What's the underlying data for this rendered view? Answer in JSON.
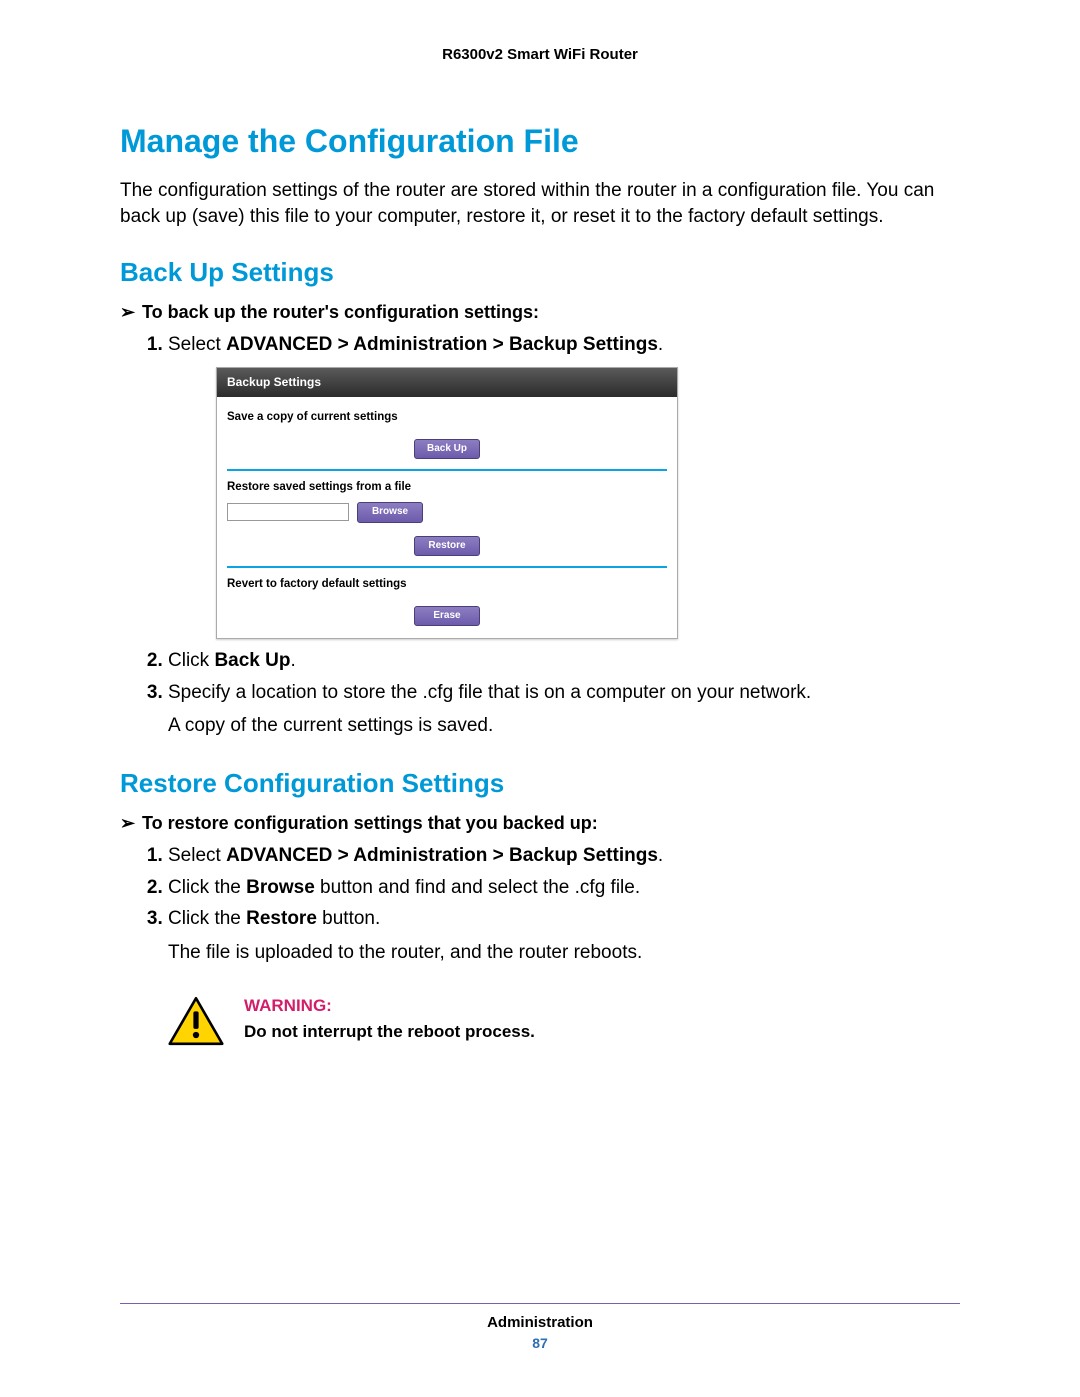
{
  "doc_header": "R6300v2 Smart WiFi Router",
  "h1": "Manage the Configuration File",
  "intro": "The configuration settings of the router are stored within the router in a configuration file. You can back up (save) this file to your computer, restore it, or reset it to the factory default settings.",
  "backup": {
    "heading": "Back Up Settings",
    "task_title": "To back up the router's configuration settings:",
    "steps": {
      "s1_pre": "Select ",
      "s1_bold": "ADVANCED > Administration > Backup Settings",
      "s1_post": ".",
      "s2_pre": "Click ",
      "s2_bold": "Back Up",
      "s2_post": ".",
      "s3": "Specify a location to store the .cfg file that is on a computer on your network.",
      "s3_note": "A copy of the current settings is saved."
    }
  },
  "panel": {
    "title": "Backup Settings",
    "save_label": "Save a copy of current settings",
    "backup_btn": "Back Up",
    "restore_label": "Restore saved settings from a file",
    "browse_btn": "Browse",
    "restore_btn": "Restore",
    "revert_label": "Revert to factory default settings",
    "erase_btn": "Erase"
  },
  "restore": {
    "heading": "Restore Configuration Settings",
    "task_title": "To restore configuration settings that you backed up:",
    "steps": {
      "s1_pre": "Select ",
      "s1_bold": "ADVANCED > Administration > Backup Settings",
      "s1_post": ".",
      "s2_pre": "Click the ",
      "s2_bold": "Browse",
      "s2_post": " button and find and select the .cfg file.",
      "s3_pre": "Click the ",
      "s3_bold": "Restore",
      "s3_post": " button.",
      "s3_note": "The file is uploaded to the router, and the router reboots."
    }
  },
  "warning": {
    "label": "WARNING:",
    "message": "Do not interrupt the reboot process."
  },
  "footer": {
    "section": "Administration",
    "page": "87"
  },
  "glyphs": {
    "task_arrow": "➢"
  }
}
